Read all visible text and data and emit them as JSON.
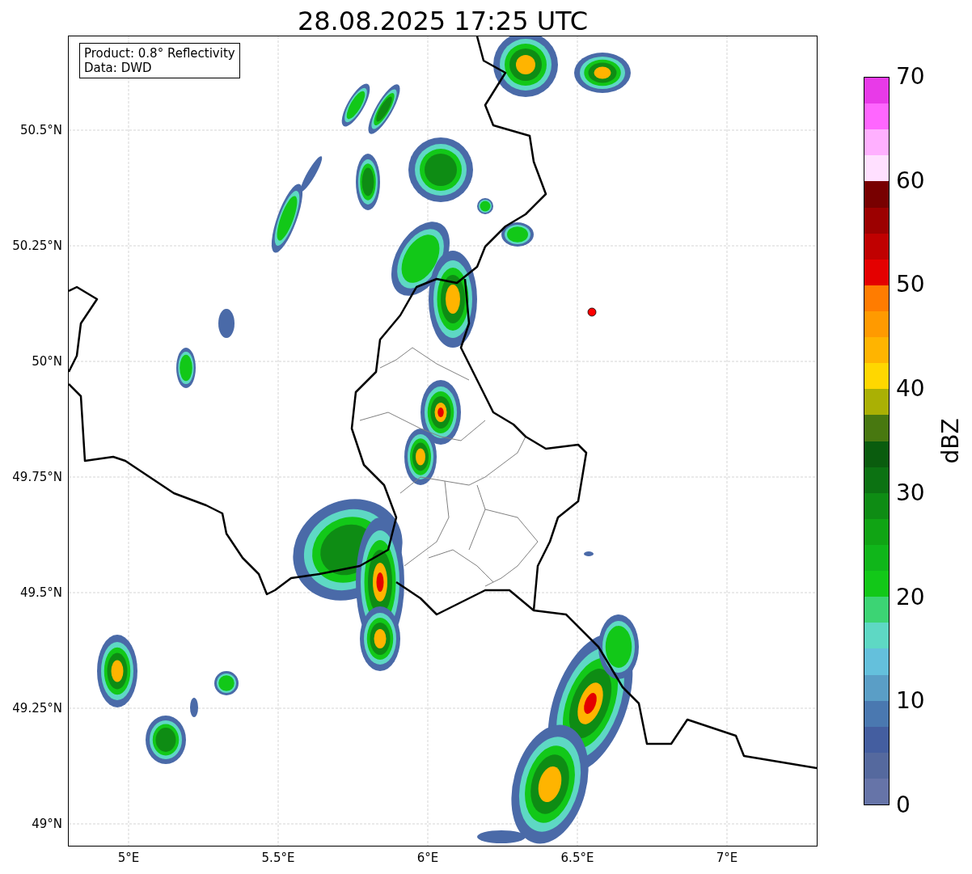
{
  "figure": {
    "title": "28.08.2025 17:25 UTC",
    "info_box": [
      "Product: 0.8° Reflectivity",
      "Data: DWD"
    ],
    "map": {
      "x_ticks": [
        "5°E",
        "5.5°E",
        "6°E",
        "6.5°E",
        "7°E"
      ],
      "y_ticks": [
        "50.5°N",
        "50.25°N",
        "50°N",
        "49.75°N",
        "49.5°N",
        "49.25°N",
        "49°N"
      ]
    },
    "colorbar": {
      "label": "dBZ",
      "ticks": [
        "70",
        "60",
        "50",
        "40",
        "30",
        "20",
        "10",
        "0"
      ],
      "segments": [
        {
          "color": "#e83ae8"
        },
        {
          "color": "#ff66ff"
        },
        {
          "color": "#ffb0ff"
        },
        {
          "color": "#ffe0ff"
        },
        {
          "color": "#780000"
        },
        {
          "color": "#9c0000"
        },
        {
          "color": "#c00000"
        },
        {
          "color": "#e40000"
        },
        {
          "color": "#ff7c00"
        },
        {
          "color": "#ff9a00"
        },
        {
          "color": "#ffb400"
        },
        {
          "color": "#ffd700"
        },
        {
          "color": "#aab004"
        },
        {
          "color": "#487810"
        },
        {
          "color": "#0a5c0e"
        },
        {
          "color": "#0c7212"
        },
        {
          "color": "#0e8c14"
        },
        {
          "color": "#10a414"
        },
        {
          "color": "#10b61a"
        },
        {
          "color": "#12c818"
        },
        {
          "color": "#3cd474"
        },
        {
          "color": "#5ed8c4"
        },
        {
          "color": "#64c0dc"
        },
        {
          "color": "#5a9ec6"
        },
        {
          "color": "#4a78b0"
        },
        {
          "color": "#445ea0"
        },
        {
          "color": "#55699e"
        },
        {
          "color": "#6674a8"
        }
      ]
    }
  }
}
